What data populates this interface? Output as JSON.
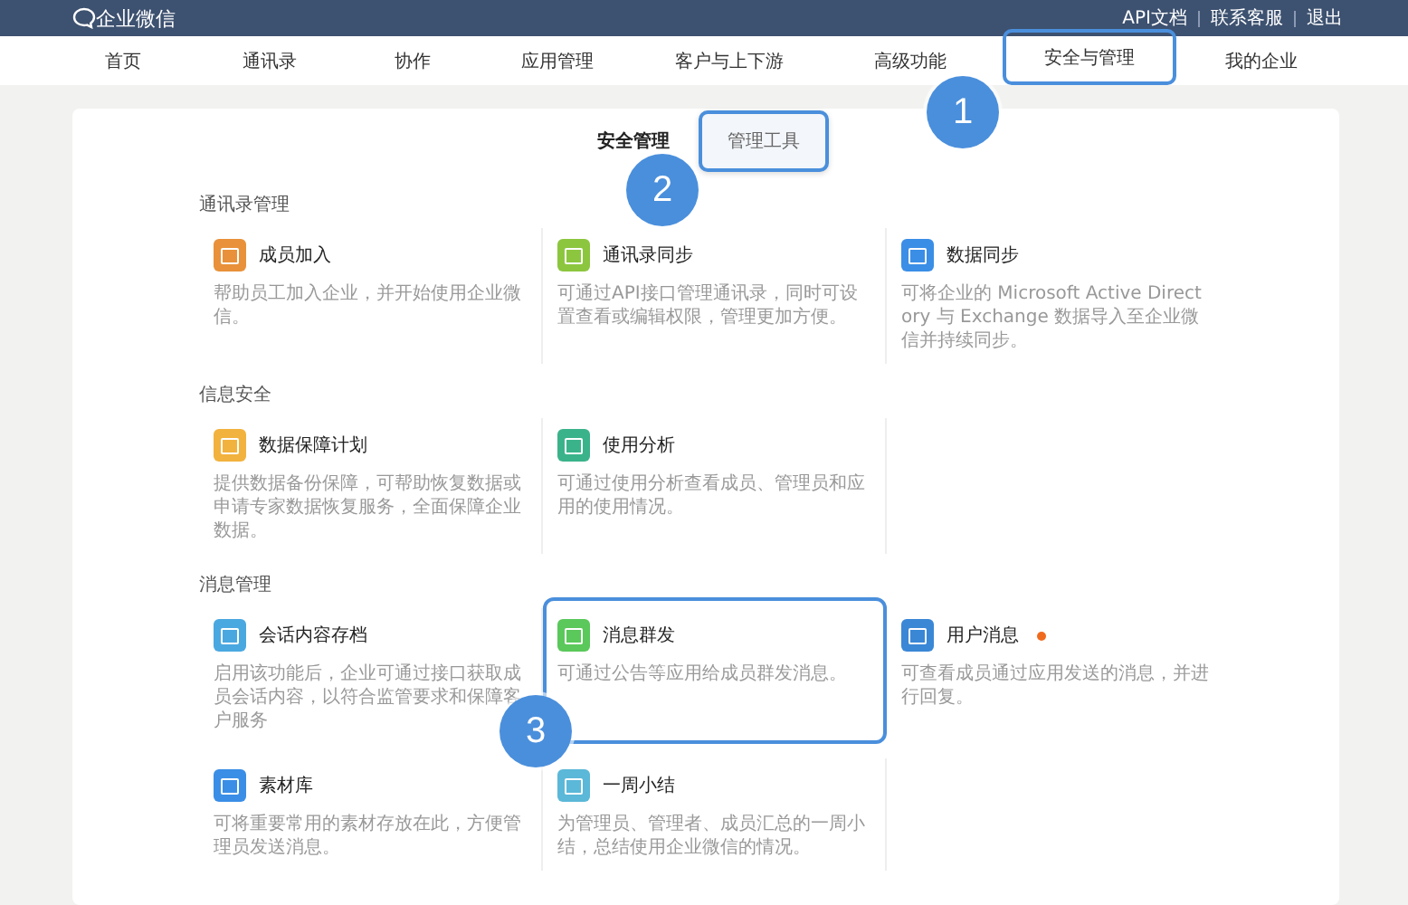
{
  "header": {
    "logo": "企业微信",
    "links": [
      "API文档",
      "联系客服",
      "退出"
    ]
  },
  "nav": [
    {
      "label": "首页",
      "highlighted": false
    },
    {
      "label": "通讯录",
      "highlighted": false
    },
    {
      "label": "协作",
      "highlighted": false
    },
    {
      "label": "应用管理",
      "highlighted": false
    },
    {
      "label": "客户与上下游",
      "highlighted": false
    },
    {
      "label": "高级功能",
      "highlighted": false
    },
    {
      "label": "安全与管理",
      "highlighted": true,
      "callout": "1"
    },
    {
      "label": "我的企业",
      "highlighted": false
    }
  ],
  "subtabs": [
    {
      "label": "安全管理",
      "selected": true,
      "highlighted": false
    },
    {
      "label": "管理工具",
      "selected": false,
      "highlighted": true,
      "callout": "2"
    }
  ],
  "sections": [
    {
      "title": "通讯录管理",
      "cards": [
        {
          "title": "成员加入",
          "description": "帮助员工加入企业，并开始使用企业微信。",
          "color": "#e8913a",
          "highlighted": false,
          "new": false
        },
        {
          "title": "通讯录同步",
          "description": "可通过API接口管理通讯录，同时可设置查看或编辑权限，管理更加方便。",
          "color": "#8cc63f",
          "highlighted": false,
          "new": false
        },
        {
          "title": "数据同步",
          "description": "可将企业的 Microsoft Active Directory 与 Exchange 数据导入至企业微信并持续同步。",
          "color": "#3a8ee6",
          "highlighted": false,
          "new": false
        }
      ]
    },
    {
      "title": "信息安全",
      "cards": [
        {
          "title": "数据保障计划",
          "description": "提供数据备份保障，可帮助恢复数据或申请专家数据恢复服务，全面保障企业数据。",
          "color": "#f2b23e",
          "highlighted": false,
          "new": false
        },
        {
          "title": "使用分析",
          "description": "可通过使用分析查看成员、管理员和应用的使用情况。",
          "color": "#3bb38a",
          "highlighted": false,
          "new": false
        }
      ]
    },
    {
      "title": "消息管理",
      "cards": [
        {
          "title": "会话内容存档",
          "description": "启用该功能后，企业可通过接口获取成员会话内容，以符合监管要求和保障客户服务",
          "color": "#4aa8e0",
          "highlighted": false,
          "new": false
        },
        {
          "title": "消息群发",
          "description": "可通过公告等应用给成员群发消息。",
          "color": "#5ac85a",
          "highlighted": true,
          "new": false,
          "callout": "3"
        },
        {
          "title": "用户消息",
          "description": "可查看成员通过应用发送的消息，并进行回复。",
          "color": "#3a87d6",
          "highlighted": false,
          "new": true
        },
        {
          "title": "素材库",
          "description": "可将重要常用的素材存放在此，方便管理员发送消息。",
          "color": "#3a8ee6",
          "highlighted": false,
          "new": false
        },
        {
          "title": "一周小结",
          "description": "为管理员、管理者、成员汇总的一周小结，总结使用企业微信的情况。",
          "color": "#5bb8d8",
          "highlighted": false,
          "new": false
        }
      ]
    }
  ]
}
